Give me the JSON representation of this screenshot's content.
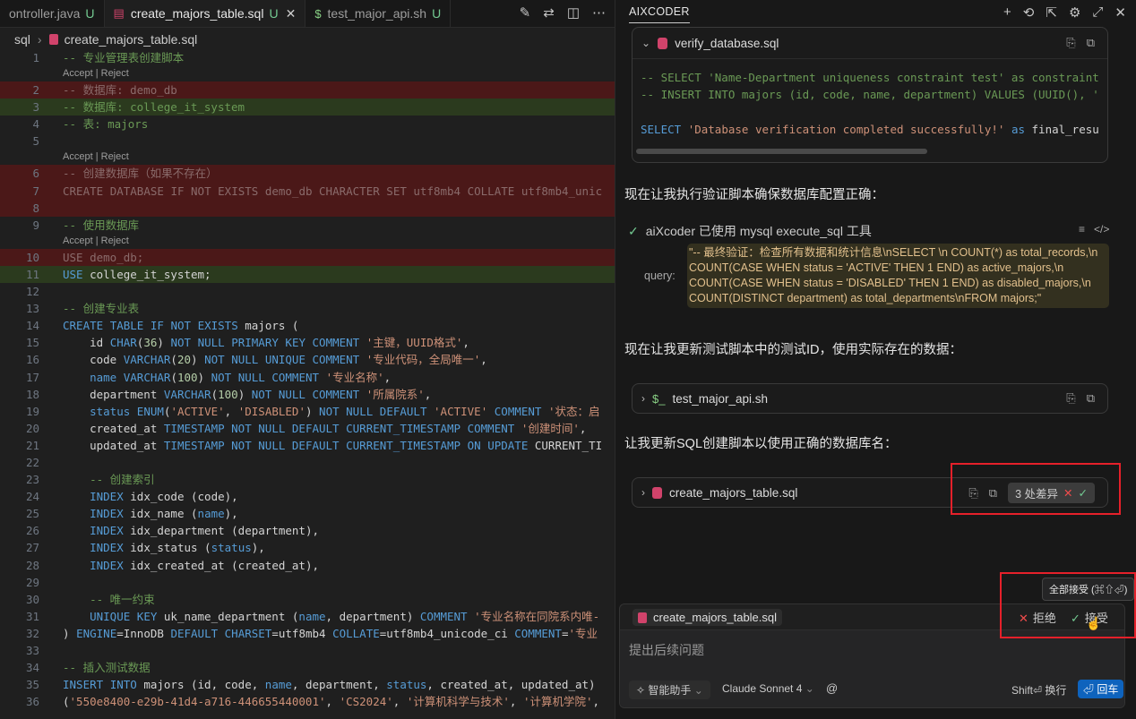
{
  "tabs": [
    {
      "label": "ontroller.java",
      "status": "U",
      "icon": "java-file-icon"
    },
    {
      "label": "create_majors_table.sql",
      "status": "U",
      "icon": "database-file-icon",
      "active": true
    },
    {
      "label": "test_major_api.sh",
      "status": "U",
      "icon": "shell-file-icon"
    }
  ],
  "breadcrumb": {
    "folder": "sql",
    "file": "create_majors_table.sql"
  },
  "codelens": {
    "accept": "Accept",
    "sep": "|",
    "reject": "Reject"
  },
  "code_lines": [
    {
      "n": "1",
      "text": "-- 专业管理表创建脚本",
      "state": ""
    },
    {
      "n": "2",
      "text": "-- 数据库: demo_db",
      "state": "del"
    },
    {
      "n": "3",
      "text": "-- 数据库: college_it_system",
      "state": "ins"
    },
    {
      "n": "4",
      "text": "-- 表: majors",
      "state": ""
    },
    {
      "n": "5",
      "text": "",
      "state": ""
    },
    {
      "n": "6",
      "text": "-- 创建数据库（如果不存在）",
      "state": "del"
    },
    {
      "n": "7",
      "text": "CREATE DATABASE IF NOT EXISTS demo_db CHARACTER SET utf8mb4 COLLATE utf8mb4_unic",
      "state": "del"
    },
    {
      "n": "8",
      "text": "",
      "state": "del"
    },
    {
      "n": "9",
      "text": "-- 使用数据库",
      "state": ""
    },
    {
      "n": "10",
      "text": "USE demo_db;",
      "state": "del"
    },
    {
      "n": "11",
      "text": "USE college_it_system;",
      "state": "ins"
    },
    {
      "n": "12",
      "text": "",
      "state": ""
    },
    {
      "n": "13",
      "text": "-- 创建专业表",
      "state": ""
    },
    {
      "n": "14",
      "text": "CREATE TABLE IF NOT EXISTS majors (",
      "state": ""
    },
    {
      "n": "15",
      "text": "    id CHAR(36) NOT NULL PRIMARY KEY COMMENT '主键，UUID格式',",
      "state": ""
    },
    {
      "n": "16",
      "text": "    code VARCHAR(20) NOT NULL UNIQUE COMMENT '专业代码，全局唯一',",
      "state": ""
    },
    {
      "n": "17",
      "text": "    name VARCHAR(100) NOT NULL COMMENT '专业名称',",
      "state": ""
    },
    {
      "n": "18",
      "text": "    department VARCHAR(100) NOT NULL COMMENT '所属院系',",
      "state": ""
    },
    {
      "n": "19",
      "text": "    status ENUM('ACTIVE', 'DISABLED') NOT NULL DEFAULT 'ACTIVE' COMMENT '状态：启",
      "state": ""
    },
    {
      "n": "20",
      "text": "    created_at TIMESTAMP NOT NULL DEFAULT CURRENT_TIMESTAMP COMMENT '创建时间',",
      "state": ""
    },
    {
      "n": "21",
      "text": "    updated_at TIMESTAMP NOT NULL DEFAULT CURRENT_TIMESTAMP ON UPDATE CURRENT_TI",
      "state": ""
    },
    {
      "n": "22",
      "text": "",
      "state": ""
    },
    {
      "n": "23",
      "text": "    -- 创建索引",
      "state": ""
    },
    {
      "n": "24",
      "text": "    INDEX idx_code (code),",
      "state": ""
    },
    {
      "n": "25",
      "text": "    INDEX idx_name (name),",
      "state": ""
    },
    {
      "n": "26",
      "text": "    INDEX idx_department (department),",
      "state": ""
    },
    {
      "n": "27",
      "text": "    INDEX idx_status (status),",
      "state": ""
    },
    {
      "n": "28",
      "text": "    INDEX idx_created_at (created_at),",
      "state": ""
    },
    {
      "n": "29",
      "text": "",
      "state": ""
    },
    {
      "n": "30",
      "text": "    -- 唯一约束",
      "state": ""
    },
    {
      "n": "31",
      "text": "    UNIQUE KEY uk_name_department (name, department) COMMENT '专业名称在同院系内唯-",
      "state": ""
    },
    {
      "n": "32",
      "text": ") ENGINE=InnoDB DEFAULT CHARSET=utf8mb4 COLLATE=utf8mb4_unicode_ci COMMENT='专业",
      "state": ""
    },
    {
      "n": "33",
      "text": "",
      "state": ""
    },
    {
      "n": "34",
      "text": "-- 插入测试数据",
      "state": ""
    },
    {
      "n": "35",
      "text": "INSERT INTO majors (id, code, name, department, status, created_at, updated_at)",
      "state": ""
    },
    {
      "n": "36",
      "text": "('550e8400-e29b-41d4-a716-446655440001', 'CS2024', '计算机科学与技术', '计算机学院',",
      "state": ""
    }
  ],
  "panel": {
    "title": "AIXCODER",
    "verify_card": {
      "filename": "verify_database.sql",
      "line1": "-- SELECT 'Name-Department uniqueness constraint test' as constraint",
      "line2": "-- INSERT INTO majors (id, code, name, department) VALUES (UUID(), '",
      "line3_kw": "SELECT",
      "line3_str": "'Database verification completed successfully!'",
      "line3_as": "as",
      "line3_rest": "final_resu"
    },
    "para1": "现在让我执行验证脚本确保数据库配置正确：",
    "tool_use": "aiXcoder 已使用 mysql execute_sql 工具",
    "query_label": "query:",
    "query_text": "\"-- 最终验证：检查所有数据和统计信息\\nSELECT \\n COUNT(*) as total_records,\\n COUNT(CASE WHEN status = 'ACTIVE' THEN 1 END) as active_majors,\\n COUNT(CASE WHEN status = 'DISABLED' THEN 1 END) as disabled_majors,\\n COUNT(DISTINCT department) as total_departments\\nFROM majors;\"",
    "para2": "现在让我更新测试脚本中的测试ID，使用实际存在的数据：",
    "shell_card": {
      "prefix": "$_",
      "filename": "test_major_api.sh"
    },
    "para3": "让我更新SQL创建脚本以使用正确的数据库名：",
    "sql_card": {
      "filename": "create_majors_table.sql",
      "diff_label": "3 处差异"
    },
    "tooltip": "全部接受 (⌘⇧⏎)",
    "chat": {
      "file_chip": "create_majors_table.sql",
      "reject": "拒绝",
      "accept": "接受",
      "placeholder": "提出后续问题",
      "assistant": "智能助手",
      "model": "Claude Sonnet 4",
      "at": "@",
      "shift_hint": "Shift⏎ 换行",
      "send": "⏎ 回车"
    }
  },
  "colors": {
    "accent": "#0e63bd",
    "highlight_red": "#e5202a",
    "deleted_bg": "#4b1818",
    "inserted_bg": "#2b3a1e"
  }
}
